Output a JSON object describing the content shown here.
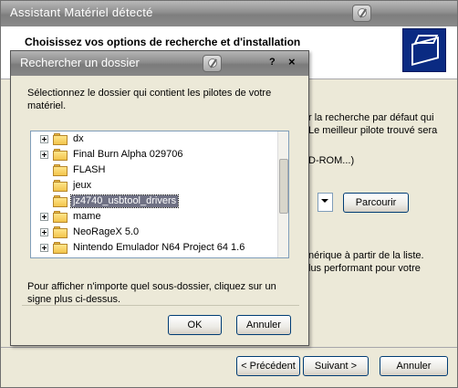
{
  "wizard": {
    "title": "Assistant Matériel détecté",
    "header_title": "Choisissez vos options de recherche et d'installation",
    "partial_texts": [
      "r la recherche par défaut qui",
      "Le meilleur pilote trouvé sera",
      "D-ROM...)",
      "nérique à partir de la liste.",
      "lus performant pour votre"
    ],
    "browse_label": "Parcourir",
    "back_label": "< Précédent",
    "next_label": "Suivant >",
    "cancel_label": "Annuler"
  },
  "dialog": {
    "title": "Rechercher un dossier",
    "help_label": "?",
    "close_label": "×",
    "description": "Sélectionnez le dossier qui contient les pilotes de votre matériel.",
    "hint": "Pour afficher n'importe quel sous-dossier, cliquez sur un signe plus ci-dessus.",
    "ok_label": "OK",
    "cancel_label": "Annuler",
    "folders": [
      {
        "label": "dx",
        "expandable": true,
        "selected": false
      },
      {
        "label": "Final Burn Alpha 029706",
        "expandable": true,
        "selected": false
      },
      {
        "label": "FLASH",
        "expandable": false,
        "selected": false
      },
      {
        "label": "jeux",
        "expandable": false,
        "selected": false
      },
      {
        "label": "jz4740_usbtool_drivers",
        "expandable": false,
        "selected": true
      },
      {
        "label": "mame",
        "expandable": true,
        "selected": false
      },
      {
        "label": "NeoRageX 5.0",
        "expandable": true,
        "selected": false
      },
      {
        "label": "Nintendo Emulador N64 Project 64 1.6",
        "expandable": true,
        "selected": false
      }
    ]
  }
}
